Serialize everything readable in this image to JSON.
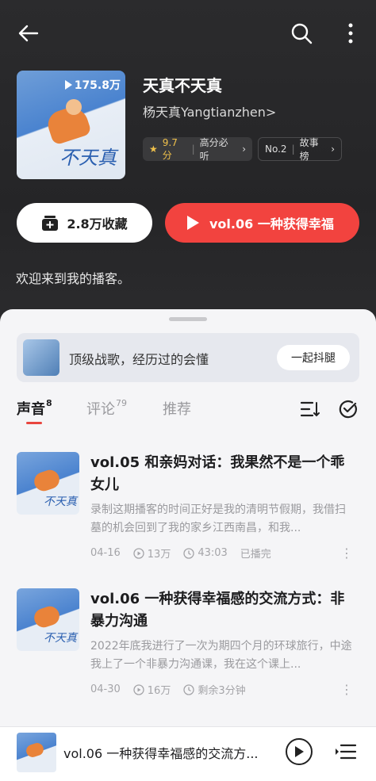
{
  "header": {
    "back_icon": "arrow-left-icon",
    "search_icon": "search-icon",
    "more_icon": "more-vertical-icon"
  },
  "podcast": {
    "title": "天真不天真",
    "author": "杨天真Yangtianzhen>",
    "play_count": "175.8万",
    "cover_script": "不天真",
    "rating_score": "9.7分",
    "rating_label": "高分必听",
    "rank_label": "No.2",
    "rank_category": "故事榜",
    "welcome": "欢迎来到我的播客。"
  },
  "actions": {
    "collect_label": "2.8万收藏",
    "play_label": "vol.06 一种获得幸福"
  },
  "banner": {
    "text": "顶级战歌，经历过的会懂",
    "button": "一起抖腿"
  },
  "tabs": [
    {
      "label": "声音",
      "count": "8"
    },
    {
      "label": "评论",
      "count": "79"
    },
    {
      "label": "推荐",
      "count": ""
    }
  ],
  "episodes": [
    {
      "title": "vol.05 和亲妈对话：我果然不是一个乖女儿",
      "desc": "录制这期播客的时间正好是我的清明节假期，我借扫墓的机会回到了我的家乡江西南昌，和我...",
      "date": "04-16",
      "plays": "13万",
      "duration": "43:03",
      "status": "已播完"
    },
    {
      "title": "vol.06 一种获得幸福感的交流方式：非暴力沟通",
      "desc": "2022年底我进行了一次为期四个月的环球旅行，中途我上了一个非暴力沟通课，我在这个课上...",
      "date": "04-30",
      "plays": "16万",
      "duration": "",
      "status": "剩余3分钟"
    }
  ],
  "mini_player": {
    "title": "vol.06 一种获得幸福感的交流方..."
  },
  "colors": {
    "accent_red": "#f2433f",
    "hero_bg": "#2b2b2d",
    "star": "#f0c14b"
  }
}
